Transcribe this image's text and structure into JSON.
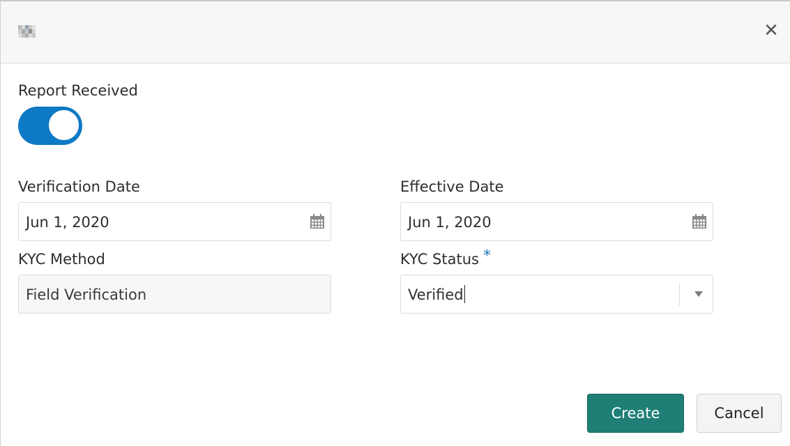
{
  "dialog": {
    "close_icon": "close-icon"
  },
  "form": {
    "report_received": {
      "label": "Report Received",
      "state": "on",
      "accent": "#0e79c4"
    },
    "verification_date": {
      "label": "Verification Date",
      "value": "Jun 1, 2020"
    },
    "effective_date": {
      "label": "Effective Date",
      "value": "Jun 1, 2020"
    },
    "kyc_method": {
      "label": "KYC Method",
      "value": "Field Verification"
    },
    "kyc_status": {
      "label": "KYC Status",
      "required_mark": "*",
      "value": "Verified"
    }
  },
  "actions": {
    "create_label": "Create",
    "cancel_label": "Cancel",
    "create_color": "#1f7f77"
  }
}
